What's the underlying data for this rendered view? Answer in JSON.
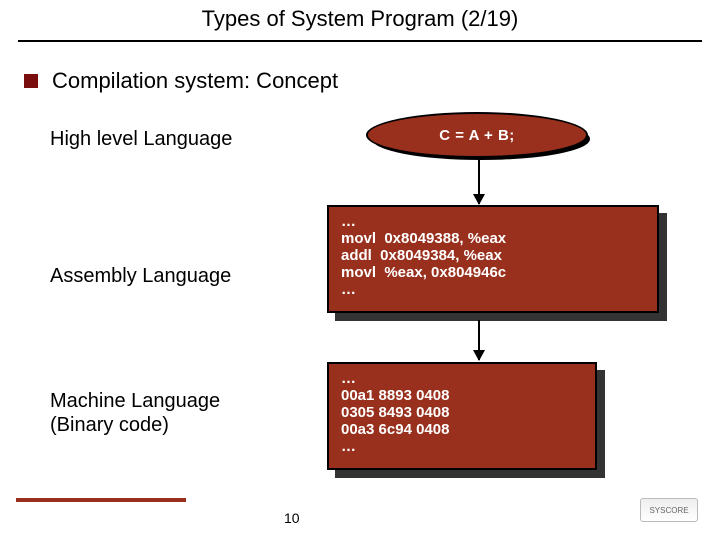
{
  "title": "Types of System Program (2/19)",
  "bullet": "Compilation system: Concept",
  "labels": {
    "high": "High level Language",
    "asm": "Assembly Language",
    "machine": "Machine Language\n(Binary code)"
  },
  "high_code": "C = A + B;",
  "asm_code": "…\nmovl  0x8049388, %eax\naddl  0x8049384, %eax\nmovl  %eax, 0x804946c\n…",
  "machine_code": "…\n00a1 8893 0408\n0305 8493 0408\n00a3 6c94 0408\n…",
  "page_number": "10",
  "logo_text": "SYSCORE",
  "colors": {
    "brick": "#99301e"
  }
}
